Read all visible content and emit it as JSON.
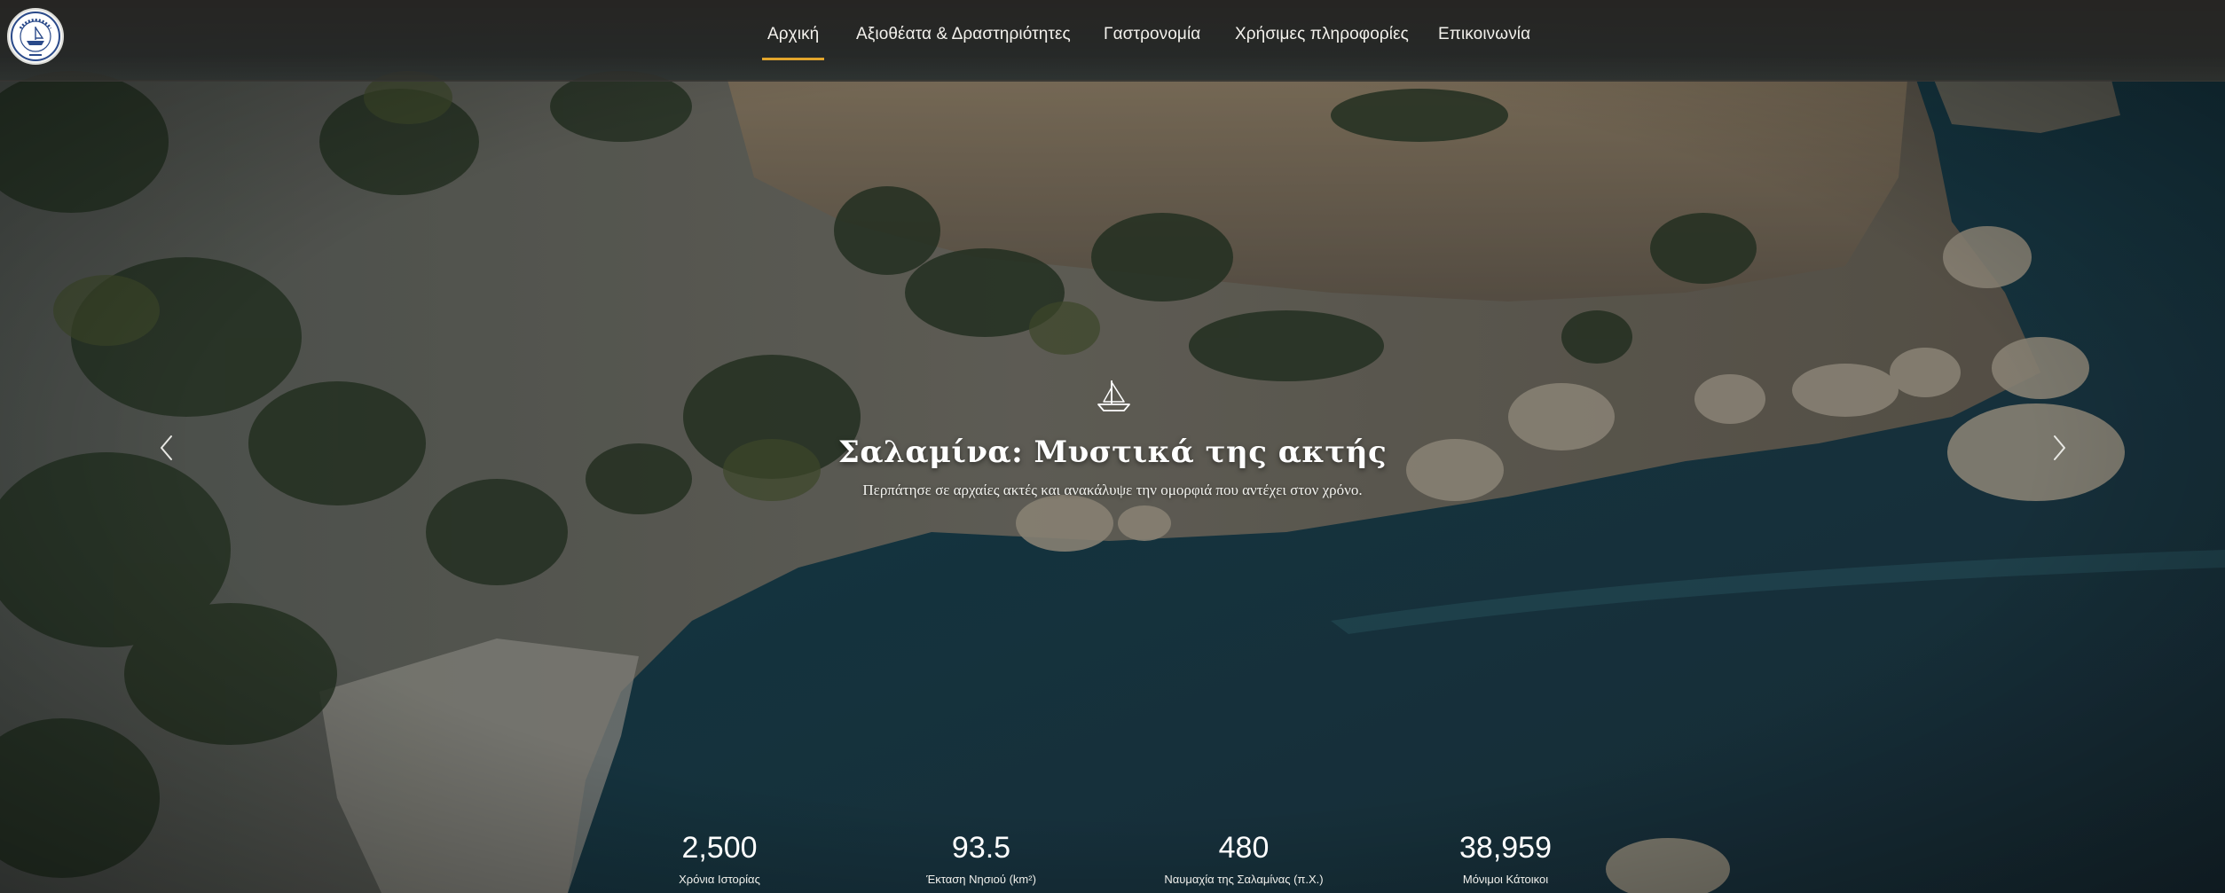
{
  "header": {
    "logo_icon": "municipality-seal-icon",
    "nav": [
      {
        "label": "Αρχική",
        "active": true
      },
      {
        "label": "Αξιοθέατα & Δραστηριότητες",
        "active": false
      },
      {
        "label": "Γαστρονομία",
        "active": false
      },
      {
        "label": "Χρήσιμες πληροφορίες",
        "active": false
      },
      {
        "label": "Επικοινωνία",
        "active": false
      }
    ],
    "active_underline_color": "#e2a52c"
  },
  "slider": {
    "icon": "sailboat-icon",
    "title": "Σαλαμίνα: Μυστικά της ακτής",
    "subtitle": "Περπάτησε σε αρχαίες ακτές και ανακάλυψε την ομορφιά που αντέχει στον χρόνο.",
    "prev_icon": "chevron-left-icon",
    "next_icon": "chevron-right-icon"
  },
  "stats": [
    {
      "value": "2,500",
      "label": "Χρόνια Ιστορίας"
    },
    {
      "value": "93.5",
      "label": "Έκταση Νησιού (km²)"
    },
    {
      "value": "480",
      "label": "Ναυμαχία της Σαλαμίνας (π.Χ.)"
    },
    {
      "value": "38,959",
      "label": "Μόνιμοι Κάτοικοι"
    }
  ]
}
